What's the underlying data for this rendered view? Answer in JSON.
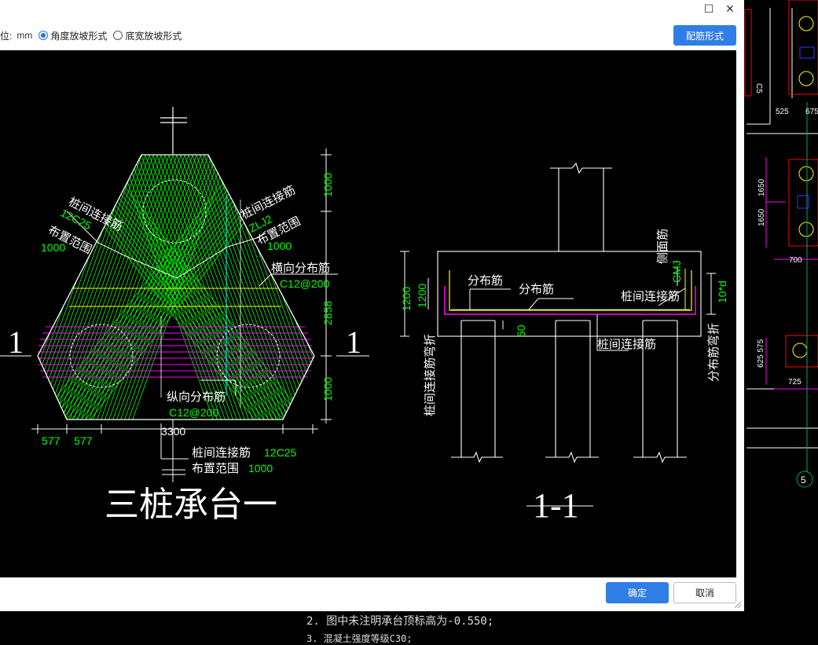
{
  "window": {
    "maximize_glyph": "☐",
    "close_glyph": "✕"
  },
  "options": {
    "unit_label": "位:",
    "unit_value": "mm",
    "radio_angle": "角度放坡形式",
    "radio_bottom": "底宽放坡形式",
    "selected": "angle"
  },
  "toolbar": {
    "config_button": "配筋形式"
  },
  "footer": {
    "ok": "确定",
    "cancel": "取消"
  },
  "drawing": {
    "plan_title": "三桩承台一",
    "section_title": "1-1",
    "section_mark": "1",
    "plan_labels": {
      "left_top_1": "桩间连接筋",
      "left_top_2": "12C25",
      "left_top_3": "布置范围",
      "left_top_4": "1000",
      "right_top_1": "桩间连接筋",
      "right_top_2": "ZLJ2",
      "right_top_3": "布置范围",
      "right_top_4": "1000",
      "transverse_1": "横向分布筋",
      "transverse_2": "C12@200",
      "longitudinal_1": "纵向分布筋",
      "longitudinal_2": "C12@200",
      "bottom_1": "桩间连接筋",
      "bottom_2": "12C25",
      "bottom_3": "布置范围",
      "bottom_4": "1000"
    },
    "plan_dims": {
      "v1": "1000",
      "v2": "2858",
      "v3": "1000",
      "total": "3300",
      "d1": "577",
      "d2": "577"
    },
    "section_labels": {
      "dist1": "分布筋",
      "dist2": "分布筋",
      "side": "侧面筋",
      "side_code": "CMJ",
      "conn_right": "桩间连接筋",
      "conn_bottom": "桩间连接筋",
      "left_bend": "桩间连接筋弯折",
      "right_bend": "分布筋弯折",
      "right_dim": "10*d",
      "h1": "1200",
      "h2": "1200",
      "d50": "50"
    }
  },
  "background": {
    "dims": [
      "525",
      "675",
      "1650",
      "1650",
      "700",
      "625 575",
      "725",
      "5"
    ],
    "side_label": "C5",
    "note1": "2. 图中未注明承台顶标高为-0.550;",
    "note2": "3. 混凝土强度等级C30;"
  },
  "colors": {
    "accent": "#2f7ee6",
    "cad_white": "#ffffff",
    "cad_green": "#00ff00",
    "cad_magenta": "#ff00ff",
    "cad_yellow": "#ffff00",
    "cad_cyan": "#00ffff",
    "cad_red": "#ff0000"
  }
}
